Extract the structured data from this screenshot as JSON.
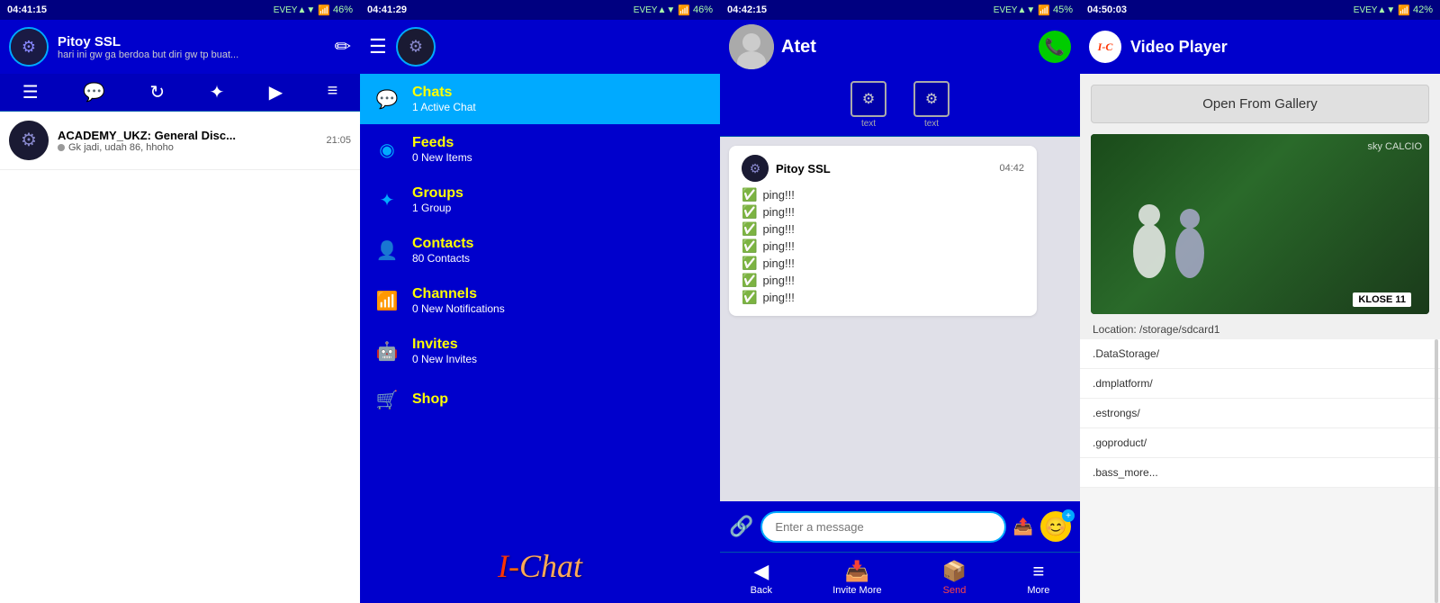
{
  "panel1": {
    "statusBar": {
      "time": "04:41:15",
      "network": "EVEY",
      "battery": "46%"
    },
    "header": {
      "name": "Pitoy SSL",
      "subtitle": "hari ini gw ga berdoa but diri gw tp buat..."
    },
    "toolbar": {
      "icons": [
        "☰",
        "💬",
        "⟳",
        "✦",
        "▶",
        "≡"
      ]
    },
    "chatList": [
      {
        "name": "ACADEMY_UKZ: General Disc...",
        "time": "21:05",
        "message": "Gk jadi, udah 86, hhoho",
        "isOnline": false
      }
    ]
  },
  "panel2": {
    "statusBar": {
      "time": "04:41:29",
      "battery": "46%"
    },
    "menuItems": [
      {
        "id": "chats",
        "icon": "💬",
        "title": "Chats",
        "subtitle": "1 Active Chat",
        "active": true
      },
      {
        "id": "feeds",
        "icon": "◉",
        "title": "Feeds",
        "subtitle": "0 New Items"
      },
      {
        "id": "groups",
        "icon": "✦",
        "title": "Groups",
        "subtitle": "1 Group"
      },
      {
        "id": "contacts",
        "icon": "👤",
        "title": "Contacts",
        "subtitle": "80 Contacts"
      },
      {
        "id": "channels",
        "icon": "📶",
        "title": "Channels",
        "subtitle": "0 New Notifications"
      },
      {
        "id": "invites",
        "icon": "🤖",
        "title": "Invites",
        "subtitle": "0 New Invites"
      },
      {
        "id": "shop",
        "icon": "🛒",
        "title": "Shop",
        "subtitle": ""
      }
    ],
    "logo": "I-Chat"
  },
  "panel3": {
    "statusBar": {
      "time": "04:42:15",
      "battery": "45%"
    },
    "contact": {
      "name": "Atet"
    },
    "message": {
      "sender": "Pitoy SSL",
      "time": "04:42",
      "lines": [
        "ping!!!",
        "ping!!!",
        "ping!!!",
        "ping!!!",
        "ping!!!",
        "ping!!!",
        "ping!!!"
      ]
    },
    "input": {
      "placeholder": "Enter a message"
    },
    "bottomNav": [
      {
        "id": "back",
        "icon": "◀",
        "label": "Back"
      },
      {
        "id": "invite",
        "icon": "📥",
        "label": "Invite More"
      },
      {
        "id": "send",
        "icon": "📦",
        "label": "Send",
        "red": true
      },
      {
        "id": "more",
        "icon": "≡",
        "label": "More"
      }
    ]
  },
  "panel4": {
    "statusBar": {
      "time": "04:50:03",
      "battery": "42%"
    },
    "title": "Video Player",
    "openGalleryBtn": "Open From Gallery",
    "location": "Location: /storage/sdcard1",
    "videoLabel": "KLOSE 11",
    "videoBranding": "sky CALCIO",
    "fileList": [
      ".DataStorage/",
      ".dmplatform/",
      ".estrongs/",
      ".goproduct/",
      ".bass_more..."
    ]
  }
}
